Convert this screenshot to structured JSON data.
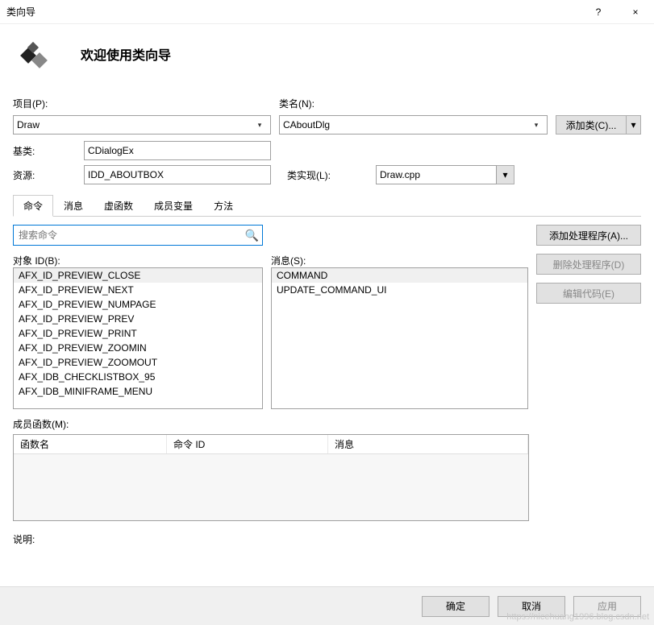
{
  "window": {
    "title": "类向导",
    "help": "?",
    "close": "×"
  },
  "header": {
    "welcome": "欢迎使用类向导"
  },
  "labels": {
    "project": "项目(P):",
    "class_name": "类名(N):",
    "base_class": "基类:",
    "resource": "资源:",
    "class_impl": "类实现(L):",
    "object_ids": "对象 ID(B):",
    "messages": "消息(S):",
    "member_funcs": "成员函数(M):",
    "description": "说明:"
  },
  "fields": {
    "project": "Draw",
    "class_name": "CAboutDlg",
    "base_class": "CDialogEx",
    "resource": "IDD_ABOUTBOX",
    "class_impl": "Draw.cpp"
  },
  "buttons": {
    "add_class": "添加类(C)...",
    "add_handler": "添加处理程序(A)...",
    "delete_handler": "删除处理程序(D)",
    "edit_code": "编辑代码(E)",
    "ok": "确定",
    "cancel": "取消",
    "apply": "应用"
  },
  "tabs": [
    "命令",
    "消息",
    "虚函数",
    "成员变量",
    "方法"
  ],
  "search_placeholder": "搜索命令",
  "object_ids": [
    "AFX_ID_PREVIEW_CLOSE",
    "AFX_ID_PREVIEW_NEXT",
    "AFX_ID_PREVIEW_NUMPAGE",
    "AFX_ID_PREVIEW_PREV",
    "AFX_ID_PREVIEW_PRINT",
    "AFX_ID_PREVIEW_ZOOMIN",
    "AFX_ID_PREVIEW_ZOOMOUT",
    "AFX_IDB_CHECKLISTBOX_95",
    "AFX_IDB_MINIFRAME_MENU"
  ],
  "messages_list": [
    "COMMAND",
    "UPDATE_COMMAND_UI"
  ],
  "table_headers": {
    "func": "函数名",
    "cmdid": "命令 ID",
    "msg": "消息"
  },
  "watermark": "https://nicehuang1996.blog.csdn.net"
}
